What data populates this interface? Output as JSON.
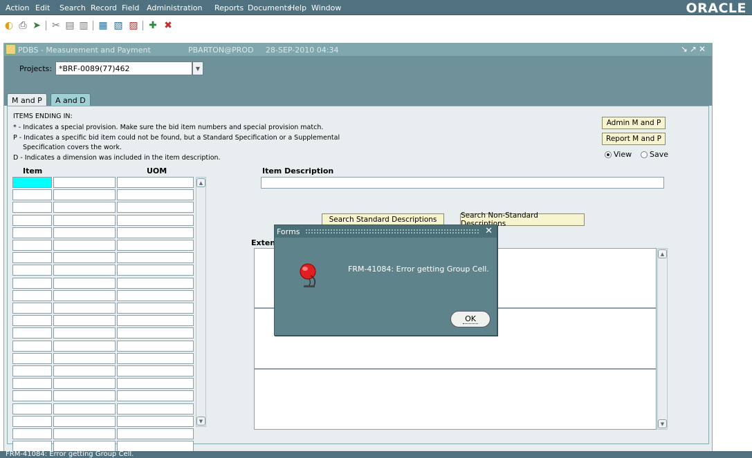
{
  "menu": [
    "Action",
    "Edit",
    "Search",
    "Record",
    "Field",
    "Administration",
    "Reports",
    "Documents",
    "Help",
    "Window"
  ],
  "brand": "ORACLE",
  "window": {
    "app": "PDBS - Measurement and Payment",
    "user": "PBARTON@PROD",
    "datetime": "28-SEP-2010 04:34"
  },
  "projects": {
    "label": "Projects:",
    "value": "*BRF-0089(77)462"
  },
  "tabs": [
    "M and P",
    "A and D"
  ],
  "notes": [
    "ITEMS ENDING IN:",
    "* - Indicates a special provision.  Make sure the bid item numbers and special provision match.",
    "P - Indicates a specific bid item could not be found, but a Standard Specification or a Supplemental",
    "Specification covers the work.",
    "D - Indicates a dimension was included in the item description."
  ],
  "columns": {
    "item": "Item",
    "uom": "UOM",
    "item_description": "Item Description",
    "extended": "Exten"
  },
  "buttons": {
    "admin": "Admin M and P",
    "report": "Report M and P",
    "search_std": "Search Standard Descriptions",
    "search_nonstd": "Search Non-Standard Descriptions"
  },
  "radios": {
    "view": "View",
    "save": "Save",
    "selected": "view"
  },
  "dialog": {
    "title": "Forms",
    "message": "FRM-41084: Error getting Group Cell.",
    "ok": "OK"
  },
  "status": "FRM-41084: Error getting Group Cell.",
  "colors": {
    "menubar": "#4f7180",
    "selected_cell": "#00ffff",
    "button": "#f6f3cf"
  }
}
